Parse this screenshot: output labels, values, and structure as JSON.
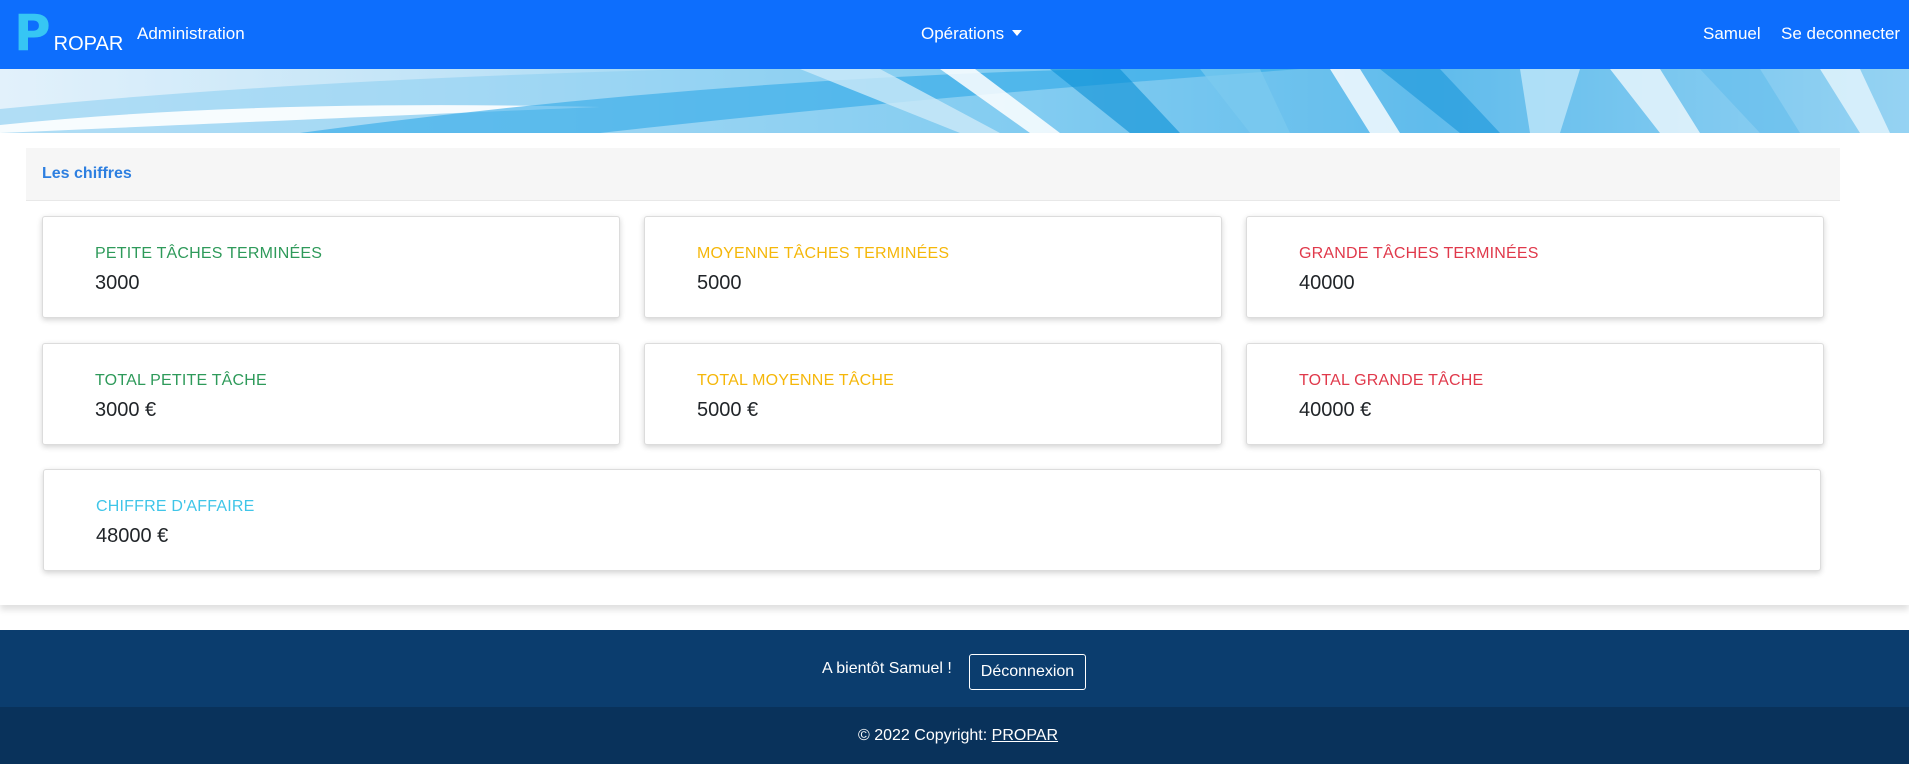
{
  "navbar": {
    "brand_letter": "P",
    "brand_text": "ROPAR",
    "admin_link": "Administration",
    "operations_dropdown": "Opérations",
    "user_link": "Samuel",
    "logout_link": "Se deconnecter"
  },
  "section": {
    "title": "Les chiffres"
  },
  "cards": [
    {
      "label": "PETITE TÂCHES TERMINÉES",
      "value": "3000",
      "color": "#2e9a5a"
    },
    {
      "label": "MOYENNE TÂCHES TERMINÉES",
      "value": "5000",
      "color": "#f5b70a"
    },
    {
      "label": "GRANDE TÂCHES TERMINÉES",
      "value": "40000",
      "color": "#e0394b"
    },
    {
      "label": "TOTAL PETITE TÂCHE",
      "value": "3000 €",
      "color": "#2e9a5a"
    },
    {
      "label": "TOTAL MOYENNE TÂCHE",
      "value": "5000 €",
      "color": "#f5b70a"
    },
    {
      "label": "TOTAL GRANDE TÂCHE",
      "value": "40000 €",
      "color": "#e0394b"
    },
    {
      "label": "CHIFFRE D'AFFAIRE",
      "value": "48000 €",
      "color": "#3fc5e8"
    }
  ],
  "footer": {
    "farewell": "A bientôt Samuel !",
    "logout_button": "Déconnexion",
    "copyright_prefix": "© 2022 Copyright: ",
    "copyright_link": "PROPAR"
  },
  "colors": {
    "navbar": "#0d6efd",
    "footer_top": "#0b3d6e",
    "footer_bottom": "#09325b",
    "section_title": "#2d7fe0"
  }
}
